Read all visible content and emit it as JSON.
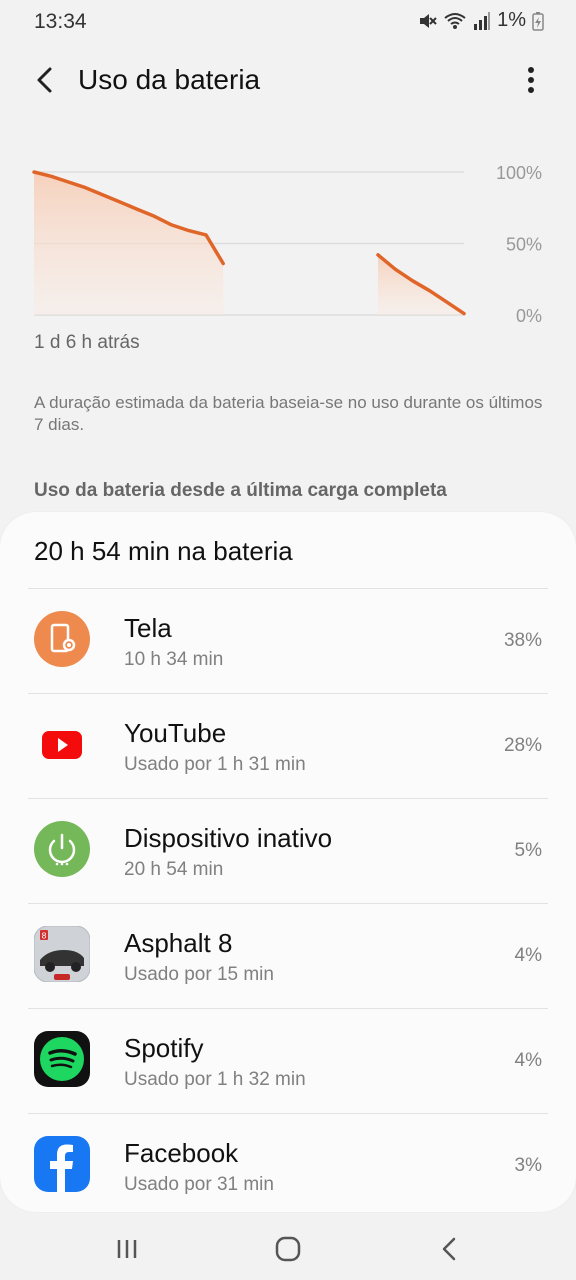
{
  "status": {
    "time": "13:34",
    "battery_level": "1%"
  },
  "header": {
    "title": "Uso da bateria"
  },
  "chart_data": {
    "type": "area",
    "ylabel_ticks": [
      "100%",
      "50%",
      "0%"
    ],
    "ylim": [
      0,
      100
    ],
    "series": [
      {
        "segment": 1,
        "x": [
          0,
          2,
          4,
          6,
          8,
          10,
          12,
          14,
          16,
          18,
          20,
          22
        ],
        "y": [
          100,
          97,
          93,
          89,
          84,
          79,
          74,
          69,
          63,
          59,
          56,
          36
        ]
      },
      {
        "segment": 2,
        "x": [
          40,
          42,
          44,
          46,
          48,
          50
        ],
        "y": [
          42,
          32,
          24,
          17,
          9,
          1
        ]
      }
    ],
    "xmax": 50,
    "x_caption": "1 d 6 h atrás",
    "colors": {
      "line": "#e06528",
      "fill": "#f8d9c8",
      "grid": "#dddddd"
    }
  },
  "note": "A duração estimada da bateria baseia-se no uso durante os últimos 7 dias.",
  "section_title": "Uso da bateria desde a última carga completa",
  "card": {
    "header": "20 h 54 min na bateria",
    "apps": [
      {
        "name": "Tela",
        "sub": "10 h 34 min",
        "pct": "38%",
        "icon": "screen-brightness-icon"
      },
      {
        "name": "YouTube",
        "sub": "Usado por 1 h 31 min",
        "pct": "28%",
        "icon": "youtube-icon"
      },
      {
        "name": "Dispositivo inativo",
        "sub": "20 h 54 min",
        "pct": "5%",
        "icon": "power-idle-icon"
      },
      {
        "name": "Asphalt 8",
        "sub": "Usado por 15 min",
        "pct": "4%",
        "icon": "asphalt8-icon"
      },
      {
        "name": "Spotify",
        "sub": "Usado por 1 h 32 min",
        "pct": "4%",
        "icon": "spotify-icon"
      },
      {
        "name": "Facebook",
        "sub": "Usado por 31 min",
        "pct": "3%",
        "icon": "facebook-icon"
      }
    ]
  },
  "nav": {
    "recents": "recents-icon",
    "home": "home-icon",
    "back": "back-icon"
  }
}
